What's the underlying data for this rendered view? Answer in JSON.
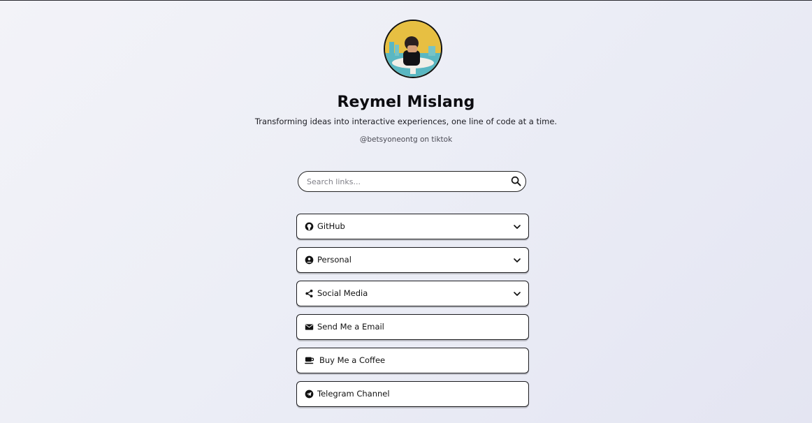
{
  "profile": {
    "name": "Reymel Mislang",
    "bio": "Transforming ideas into interactive experiences, one line of code at a time.",
    "handle": "@betsyoneontg on tiktok"
  },
  "search": {
    "placeholder": "Search links...",
    "value": "",
    "icon": "search-icon"
  },
  "links": [
    {
      "label": "GitHub",
      "icon": "github-icon",
      "expandable": true
    },
    {
      "label": "Personal",
      "icon": "user-circle-icon",
      "expandable": true
    },
    {
      "label": "Social Media",
      "icon": "share-icon",
      "expandable": true
    },
    {
      "label": "Send Me a Email",
      "icon": "envelope-icon",
      "expandable": false
    },
    {
      "label": "Buy Me a Coffee",
      "icon": "coffee-icon",
      "expandable": false
    },
    {
      "label": "Telegram Channel",
      "icon": "telegram-icon",
      "expandable": false
    }
  ],
  "colors": {
    "border": "#1b1b1f",
    "card": "#ffffff",
    "background": "#eceef6",
    "avatar_bg": "#e7bf42"
  }
}
